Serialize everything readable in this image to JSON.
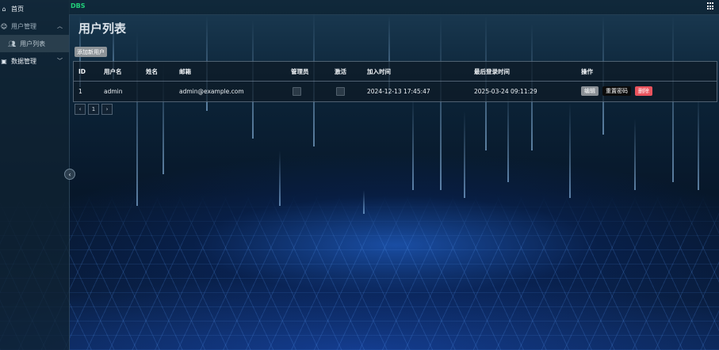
{
  "brand": "DBS",
  "sidebar": {
    "items": [
      {
        "label": "首页",
        "icon": "home-icon"
      },
      {
        "label": "用户管理",
        "icon": "user-manage-icon",
        "arrow": "︿"
      },
      {
        "label": "数据管理",
        "icon": "data-manage-icon",
        "arrow": "﹀"
      }
    ],
    "sub_items": [
      {
        "label": "用户列表",
        "icon": "users-icon"
      }
    ],
    "collapse_glyph": "‹"
  },
  "page": {
    "title": "用户列表",
    "add_button": "添加新用户"
  },
  "table": {
    "headers": [
      "ID",
      "用户名",
      "姓名",
      "邮箱",
      "管理员",
      "激活",
      "加入时间",
      "最后登录时间",
      "操作"
    ],
    "rows": [
      {
        "id": "1",
        "username": "admin",
        "name": "",
        "email": "admin@example.com",
        "is_admin": true,
        "is_active": true,
        "joined": "2024-12-13 17:45:47",
        "last_login": "2025-03-24 09:11:29",
        "actions": [
          "编辑",
          "重置密码",
          "删除"
        ]
      }
    ]
  },
  "pagination": {
    "prev": "‹",
    "current": "1",
    "next": "›"
  },
  "colors": {
    "brand": "#21d07a",
    "delete": "#e9535d",
    "edit": "#8a9096",
    "reset": "#0b0b0b"
  }
}
